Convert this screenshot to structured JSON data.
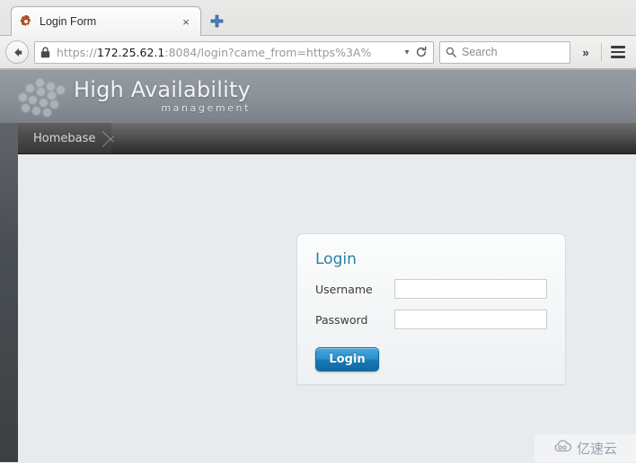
{
  "browser": {
    "tab": {
      "title": "Login Form",
      "favicon_icon": "gear-icon",
      "close_icon": "×"
    },
    "new_tab_icon": "plus-icon",
    "back_icon": "back-arrow-icon",
    "lock_icon": "padlock-icon",
    "url": {
      "scheme": "https://",
      "host": "172.25.62.1",
      "rest": ":8084/login?came_from=https%3A%",
      "full": "https://172.25.62.1:8084/login?came_from=https%3A%"
    },
    "url_dropdown_icon": "chevron-down-icon",
    "reload_icon": "reload-icon",
    "search": {
      "placeholder": "Search",
      "icon": "search-icon",
      "value": ""
    },
    "overflow_icon": "chevron-double-right-icon",
    "menu_icon": "hamburger-menu-icon"
  },
  "app": {
    "brand": {
      "title": "High Availability",
      "subtitle": "management",
      "logo_icon": "honeycomb-dots-logo"
    },
    "breadcrumb": {
      "items": [
        "Homebase"
      ],
      "separator_icon": "chevron-right-icon"
    }
  },
  "login": {
    "title": "Login",
    "username": {
      "label": "Username",
      "value": "",
      "placeholder": ""
    },
    "password": {
      "label": "Password",
      "value": "",
      "placeholder": ""
    },
    "submit_label": "Login"
  },
  "watermark": {
    "text": "亿速云",
    "icon": "cloud-logo-icon"
  },
  "colors": {
    "accent_blue": "#2b7fa0",
    "button_blue_top": "#44a6dd",
    "button_blue_bottom": "#1169a4",
    "header_gray": "#8d939a",
    "nav_dark": "#3b3b3b",
    "content_bg": "#e8ebed",
    "rail_dark": "#3c4043"
  }
}
